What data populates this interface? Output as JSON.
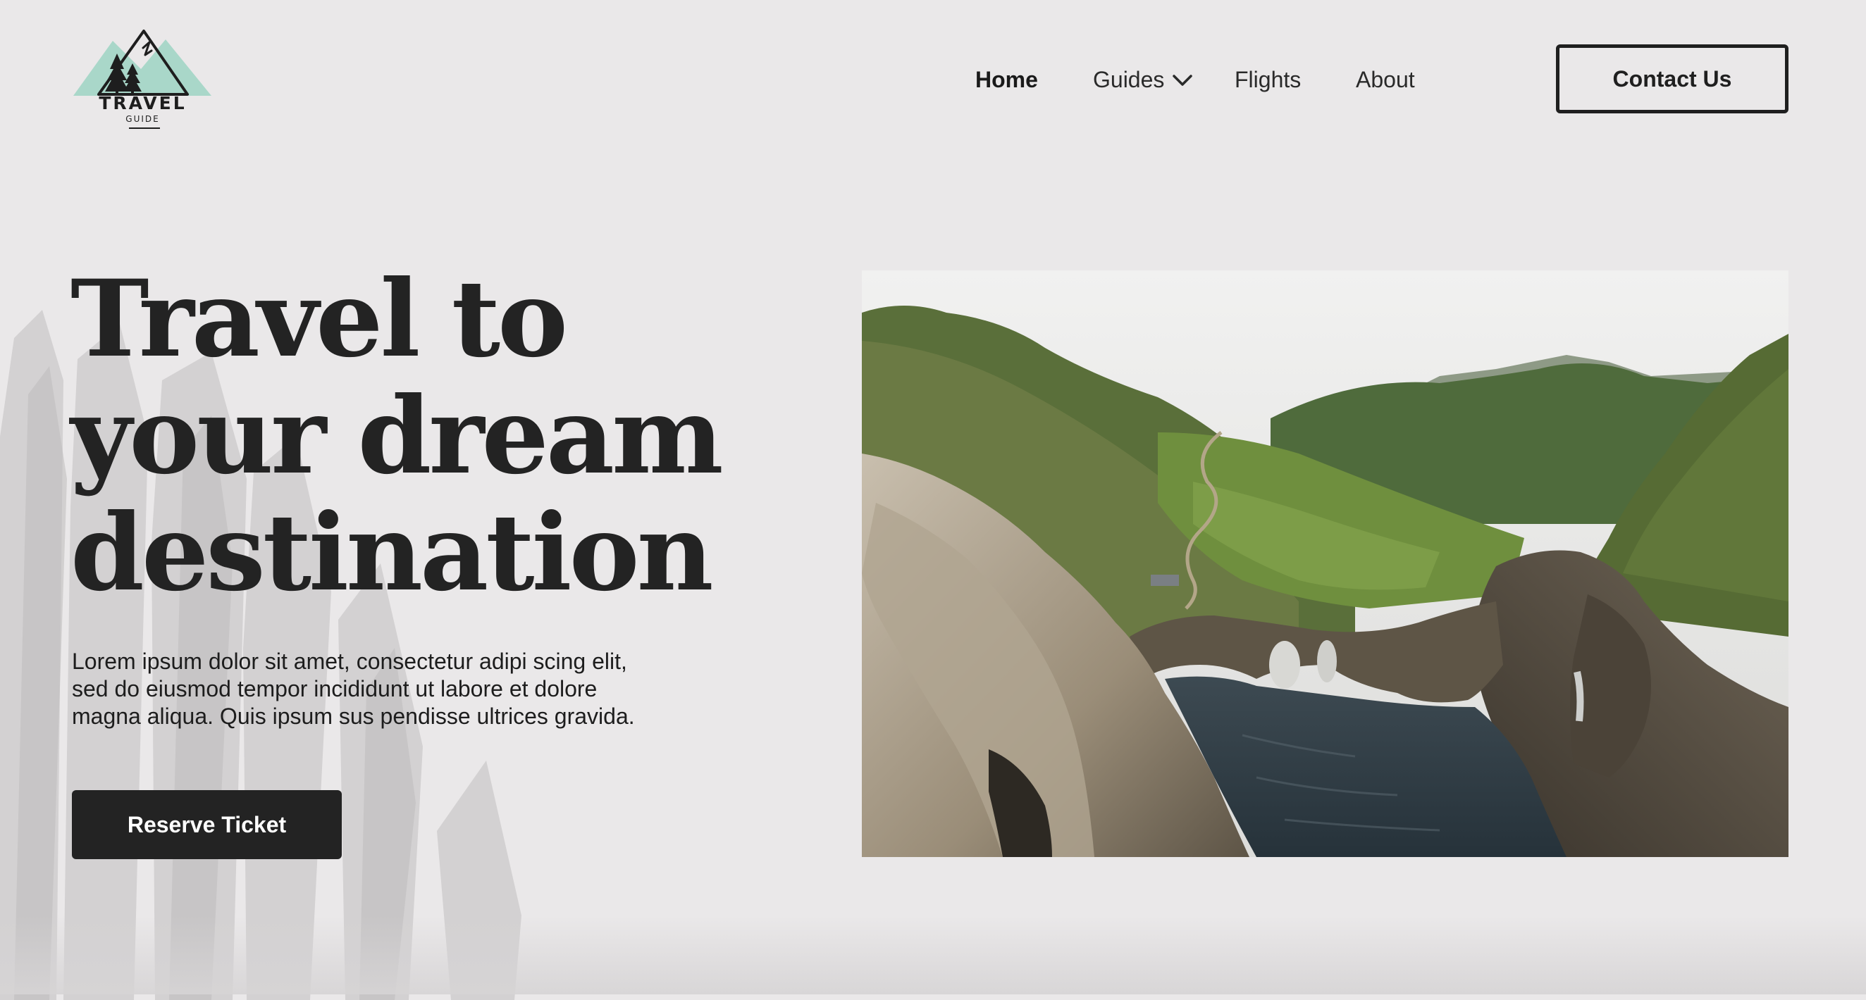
{
  "brand": {
    "name": "TRAVEL",
    "tagline": "GUIDE",
    "logo_icon": "mountain-trees-logo-icon",
    "accent_color": "#a9d7c9"
  },
  "nav": {
    "items": [
      {
        "label": "Home",
        "active": true
      },
      {
        "label": "Guides",
        "has_dropdown": true,
        "icon": "chevron-down-icon"
      },
      {
        "label": "Flights"
      },
      {
        "label": "About"
      }
    ],
    "contact_label": "Contact Us"
  },
  "hero": {
    "title_lines": [
      "Travel to",
      "your dream",
      "destination"
    ],
    "description": "Lorem ipsum dolor sit amet, consectetur adipi scing elit, sed do eiusmod tempor incididunt ut labore et dolore magna aliqua. Quis ipsum sus pendisse ultrices gravida.",
    "cta_label": "Reserve Ticket",
    "image": "coastal-cliffs-cove-photo"
  },
  "colors": {
    "background": "#eae8e9",
    "text": "#222222",
    "button_dark": "#232323"
  }
}
